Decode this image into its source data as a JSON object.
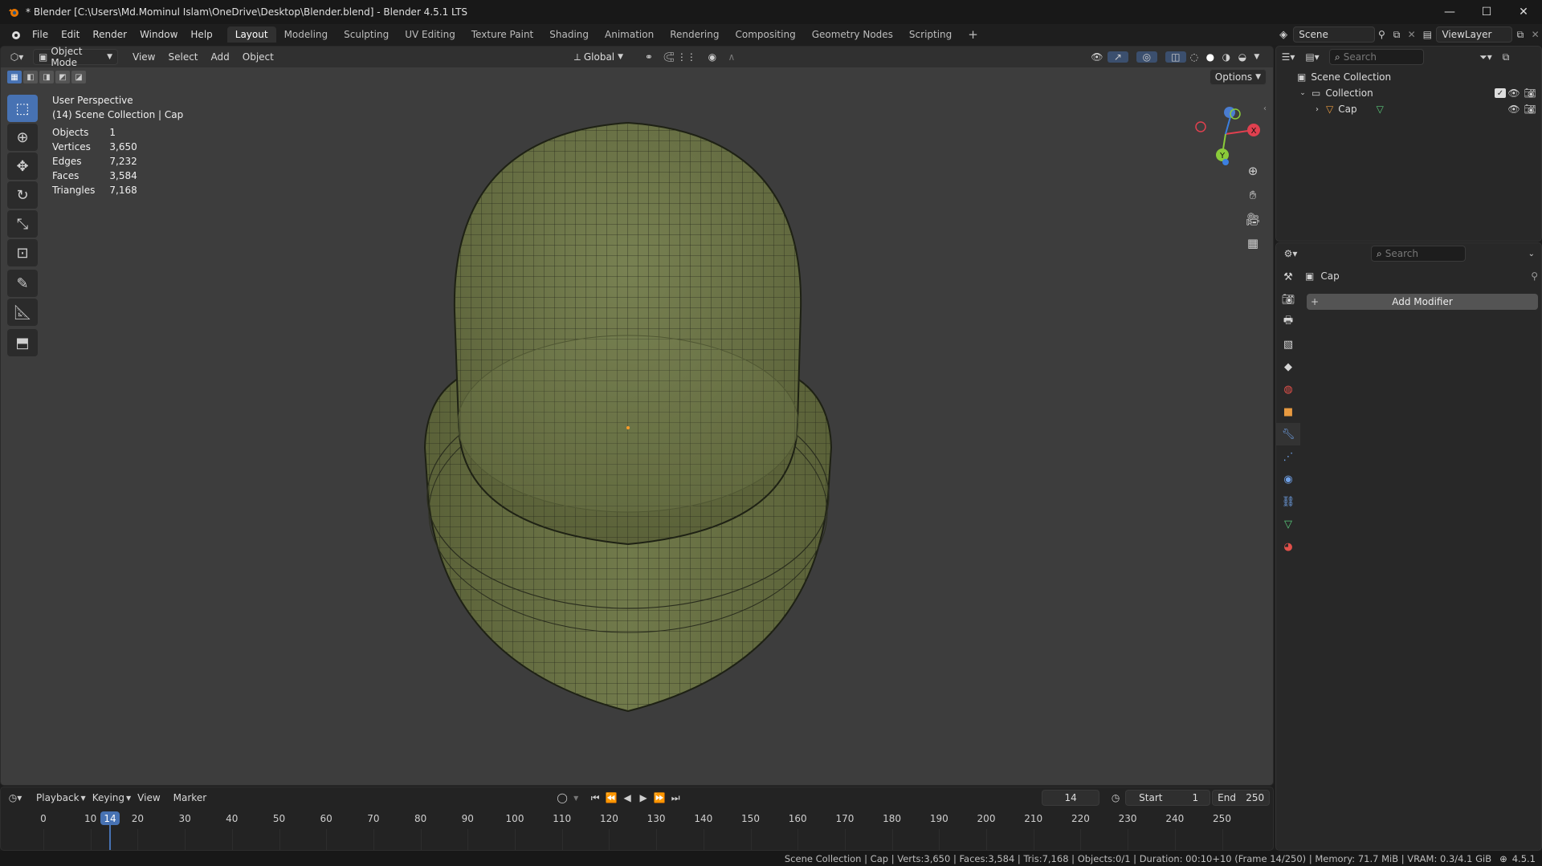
{
  "titlebar": {
    "title": "* Blender [C:\\Users\\Md.Mominul Islam\\OneDrive\\Desktop\\Blender.blend] - Blender 4.5.1 LTS",
    "minimize": "—",
    "maximize": "☐",
    "close": "✕"
  },
  "menu": [
    "File",
    "Edit",
    "Render",
    "Window",
    "Help"
  ],
  "workspaces": [
    "Layout",
    "Modeling",
    "Sculpting",
    "UV Editing",
    "Texture Paint",
    "Shading",
    "Animation",
    "Rendering",
    "Compositing",
    "Geometry Nodes",
    "Scripting"
  ],
  "active_workspace": "Layout",
  "add_workspace": "+",
  "top_right": {
    "scene": "Scene",
    "view_layer": "ViewLayer"
  },
  "viewport": {
    "mode": "Object Mode",
    "menus": [
      "View",
      "Select",
      "Add",
      "Object"
    ],
    "transform_orientation": "Global",
    "options": "Options",
    "overlay_title": "User Perspective",
    "overlay_sub": "(14) Scene Collection | Cap",
    "stats": [
      {
        "label": "Objects",
        "value": "1"
      },
      {
        "label": "Vertices",
        "value": "3,650"
      },
      {
        "label": "Edges",
        "value": "7,232"
      },
      {
        "label": "Faces",
        "value": "3,584"
      },
      {
        "label": "Triangles",
        "value": "7,168"
      }
    ],
    "gizmo": {
      "x": "X",
      "y": "Y"
    }
  },
  "outliner": {
    "search_placeholder": "Search",
    "scene_collection": "Scene Collection",
    "collection": "Collection",
    "object": "Cap"
  },
  "properties": {
    "search_placeholder": "Search",
    "object_name": "Cap",
    "add_modifier": "Add Modifier"
  },
  "timeline": {
    "menus": [
      "Playback",
      "Keying",
      "View",
      "Marker"
    ],
    "current_frame": "14",
    "start_label": "Start",
    "start": "1",
    "end_label": "End",
    "end": "250",
    "ticks": [
      "0",
      "10",
      "20",
      "30",
      "40",
      "50",
      "60",
      "70",
      "80",
      "90",
      "100",
      "110",
      "120",
      "130",
      "140",
      "150",
      "160",
      "170",
      "180",
      "190",
      "200",
      "210",
      "220",
      "230",
      "240",
      "250"
    ]
  },
  "statusbar": {
    "text": "Scene Collection | Cap | Verts:3,650 | Faces:3,584 | Tris:7,168 | Objects:0/1 | Duration: 00:10+10 (Frame 14/250) | Memory: 71.7 MiB | VRAM: 0.3/4.1 GiB",
    "version": "4.5.1"
  },
  "colors": {
    "accent": "#4772b3",
    "mesh": "#6b7446",
    "viewport_bg": "#3d3d3d"
  }
}
